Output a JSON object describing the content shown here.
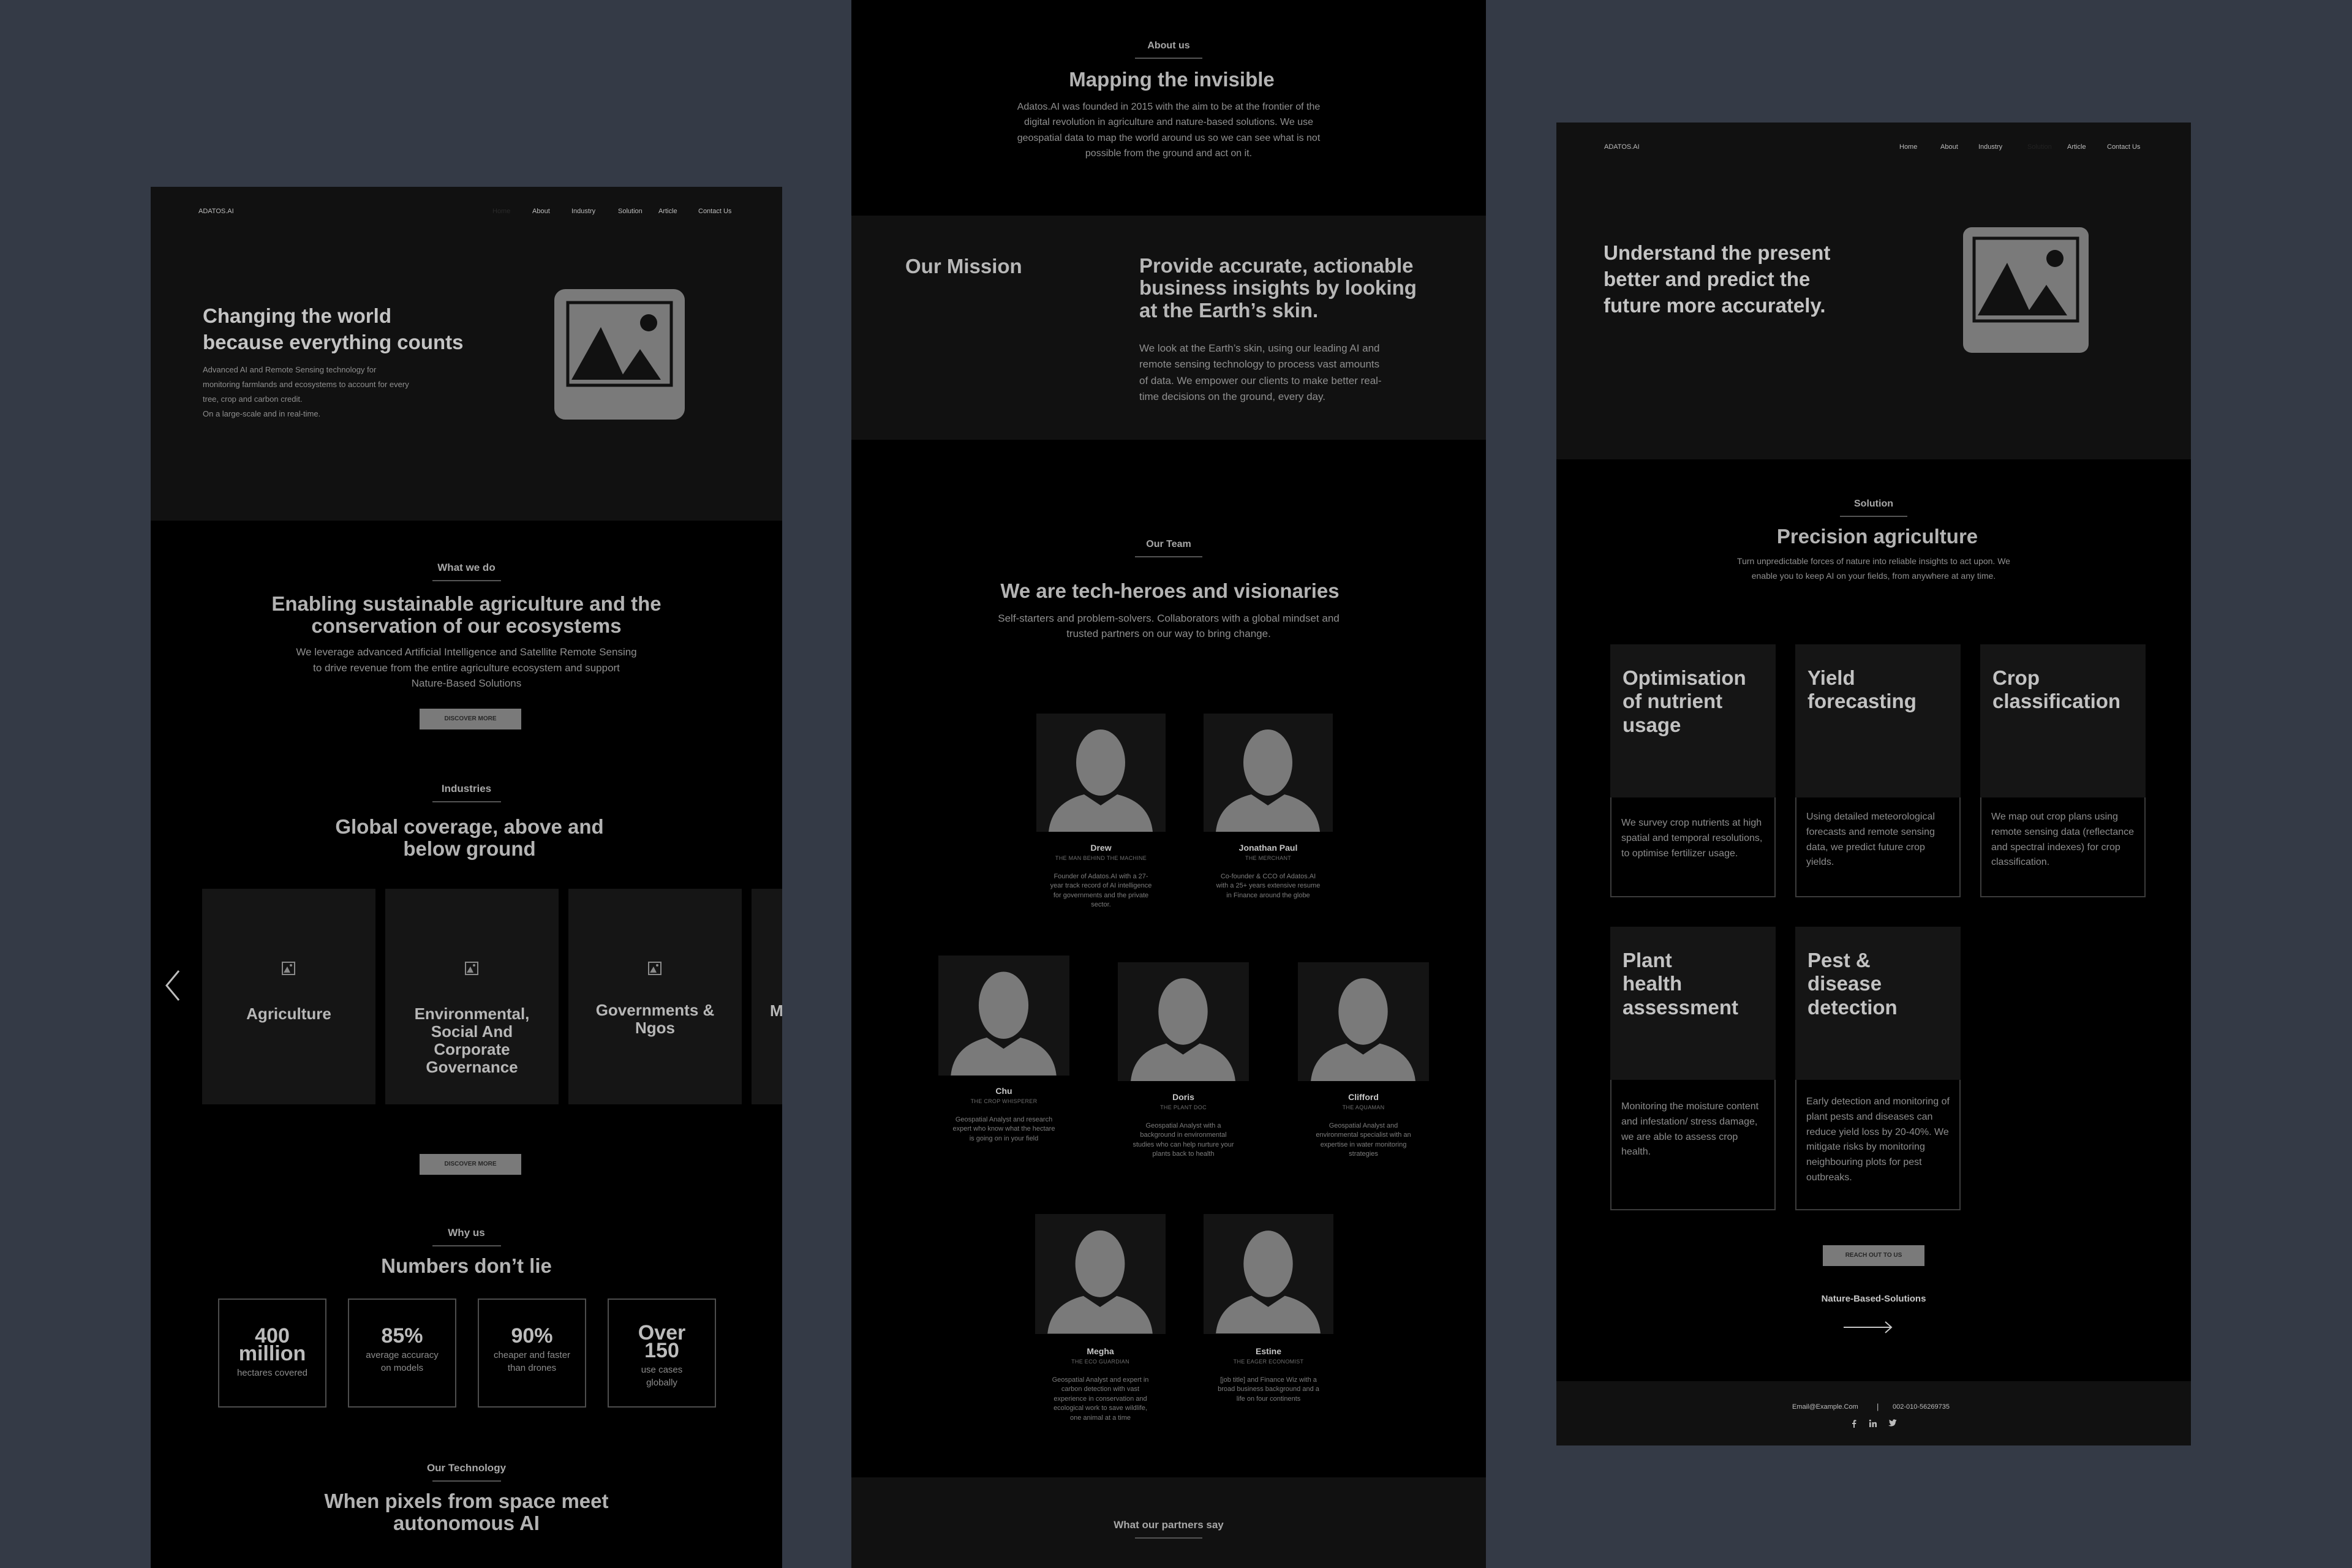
{
  "colors": {
    "background": "#343a46",
    "panel": "#000000",
    "section": "#111111",
    "card": "#151515",
    "button": "#7a7a7a",
    "text": "#9b9b9b"
  },
  "home": {
    "logo": "ADATOS.AI",
    "nav": [
      "Home",
      "About",
      "Industry",
      "Solution",
      "Article",
      "Contact Us"
    ],
    "hero": {
      "title_1": "Changing the world",
      "title_2": "because everything counts",
      "desc_1": "Advanced AI and Remote Sensing technology for",
      "desc_2": "monitoring farmlands and ecosystems to account for every",
      "desc_3": "tree, crop and carbon credit.",
      "desc_4": "On a large-scale and in real-time.",
      "image_icon": "image-placeholder-icon"
    },
    "what_we_do": {
      "eyebrow": "What we do",
      "title_1": "Enabling sustainable agriculture and the",
      "title_2": "conservation of our ecosystems",
      "desc_1": "We leverage advanced Artificial Intelligence and Satellite Remote Sensing",
      "desc_2": "to drive revenue from the entire agriculture ecosystem and support",
      "desc_3": "Nature-Based Solutions",
      "button": "DISCOVER MORE"
    },
    "industries": {
      "eyebrow": "Industries",
      "title_1": "Global coverage, above and",
      "title_2": "below ground",
      "cards": [
        {
          "l1": "Agriculture",
          "l2": "",
          "l3": "",
          "l4": ""
        },
        {
          "l1": "Environmental,",
          "l2": "Social And",
          "l3": "Corporate",
          "l4": "Governance"
        },
        {
          "l1": "Governments &",
          "l2": "Ngos",
          "l3": "",
          "l4": ""
        },
        {
          "l1": "Ma",
          "l2": "",
          "l3": "",
          "l4": ""
        }
      ],
      "button": "DISCOVER MORE"
    },
    "why_us": {
      "eyebrow": "Why us",
      "title": "Numbers don’t lie",
      "stats": [
        {
          "v1": "400",
          "v2": "million",
          "l1": "hectares covered",
          "l2": "",
          "l3": ""
        },
        {
          "v1": "85%",
          "v2": "",
          "l1": "average accuracy",
          "l2": "on models",
          "l3": ""
        },
        {
          "v1": "90%",
          "v2": "",
          "l1": "cheaper and faster",
          "l2": "than drones",
          "l3": ""
        },
        {
          "v1": "Over",
          "v2": "150",
          "l1": "use cases",
          "l2": "globally",
          "l3": ""
        }
      ]
    },
    "technology": {
      "eyebrow": "Our Technology",
      "title_1": "When pixels from space meet",
      "title_2": "autonomous AI"
    }
  },
  "about": {
    "eyebrow": "About us",
    "title": "Mapping the invisible",
    "desc_1": "Adatos.AI was founded in 2015 with the aim to be at the frontier of the",
    "desc_2": "digital revolution in agriculture and nature-based solutions. We use",
    "desc_3": "geospatial data to map the world around us so we can see what is not",
    "desc_4": "possible from the ground and act on it.",
    "mission": {
      "label": "Our Mission",
      "title_1": "Provide accurate, actionable",
      "title_2": "business insights by looking",
      "title_3": "at the Earth’s skin.",
      "desc_1": "We look at the Earth’s skin, using our leading AI and",
      "desc_2": "remote sensing technology to process vast amounts",
      "desc_3": "of data. We empower our clients to make better real-",
      "desc_4": "time decisions on the ground, every day."
    },
    "team": {
      "eyebrow": "Our Team",
      "title": "We are tech-heroes and visionaries",
      "desc_1": "Self-starters and problem-solvers. Collaborators with a global mindset and",
      "desc_2": "trusted partners on our way to bring change.",
      "members": [
        {
          "name": "Drew",
          "role": "THE MAN BEHIND THE MACHINE",
          "desc": "Founder of Adatos.AI with a 27-year track record of AI intelligence for governments and the private sector."
        },
        {
          "name": "Jonathan Paul",
          "role": "THE MERCHANT",
          "desc": "Co-founder & CCO of Adatos.AI with a 25+ years extensive resume in Finance around the globe"
        },
        {
          "name": "Chu",
          "role": "THE CROP WHISPERER",
          "desc": "Geospatial Analyst and research expert who know what the hectare is going on in your field"
        },
        {
          "name": "Doris",
          "role": "THE PLANT DOC",
          "desc": "Geospatial Analyst with a background in environmental studies who can help nurture your plants back to health"
        },
        {
          "name": "Clifford",
          "role": "THE AQUAMAN",
          "desc": "Geospatial Analyst and environmental specialist with an expertise in water monitoring strategies"
        },
        {
          "name": "Megha",
          "role": "THE ECO GUARDIAN",
          "desc": "Geospatial Analyst and expert in carbon detection with vast experience in conservation and ecological work to save wildlife, one animal at a time"
        },
        {
          "name": "Estine",
          "role": "THE EAGER ECONOMIST",
          "desc": "[job title] and Finance Wiz with a broad business background and a life on four continents"
        }
      ]
    },
    "partners_eyebrow": "What our partners say"
  },
  "solution": {
    "logo": "ADATOS.AI",
    "nav": [
      "Home",
      "About",
      "Industry",
      "Solution",
      "Article",
      "Contact Us"
    ],
    "hero": {
      "title_1": "Understand the present",
      "title_2": "better and predict the",
      "title_3": "future more accurately."
    },
    "eyebrow": "Solution",
    "title": "Precision agriculture",
    "desc_1": "Turn unpredictable forces of nature into reliable insights to act upon. We",
    "desc_2": "enable you to keep AI on your fields, from anywhere at any time.",
    "cards": [
      {
        "t1": "Optimisation",
        "t2": "of nutrient",
        "t3": "usage",
        "desc": "We survey crop nutrients at high spatial and temporal resolutions, to optimise fertilizer usage."
      },
      {
        "t1": "Yield",
        "t2": "forecasting",
        "t3": "",
        "desc": "Using detailed meteorological forecasts and remote sensing data, we predict future crop yields."
      },
      {
        "t1": "Crop",
        "t2": "classification",
        "t3": "",
        "desc": "We map out crop plans using remote sensing data (reflectance and spectral indexes) for crop classification."
      },
      {
        "t1": "Plant",
        "t2": "health",
        "t3": "assessment",
        "desc": "Monitoring the moisture content and infestation/ stress damage, we are able to assess crop health."
      },
      {
        "t1": "Pest &",
        "t2": "disease",
        "t3": "detection",
        "desc": "Early detection and monitoring of plant pests and diseases can reduce yield loss by 20-40%. We mitigate risks by monitoring neighbouring plots for pest outbreaks."
      }
    ],
    "button": "REACH OUT TO US",
    "nbs_link": "Nature-Based-Solutions",
    "footer": {
      "email": "Email@Example.Com",
      "divider": "|",
      "phone": "002-010-56269735"
    }
  }
}
